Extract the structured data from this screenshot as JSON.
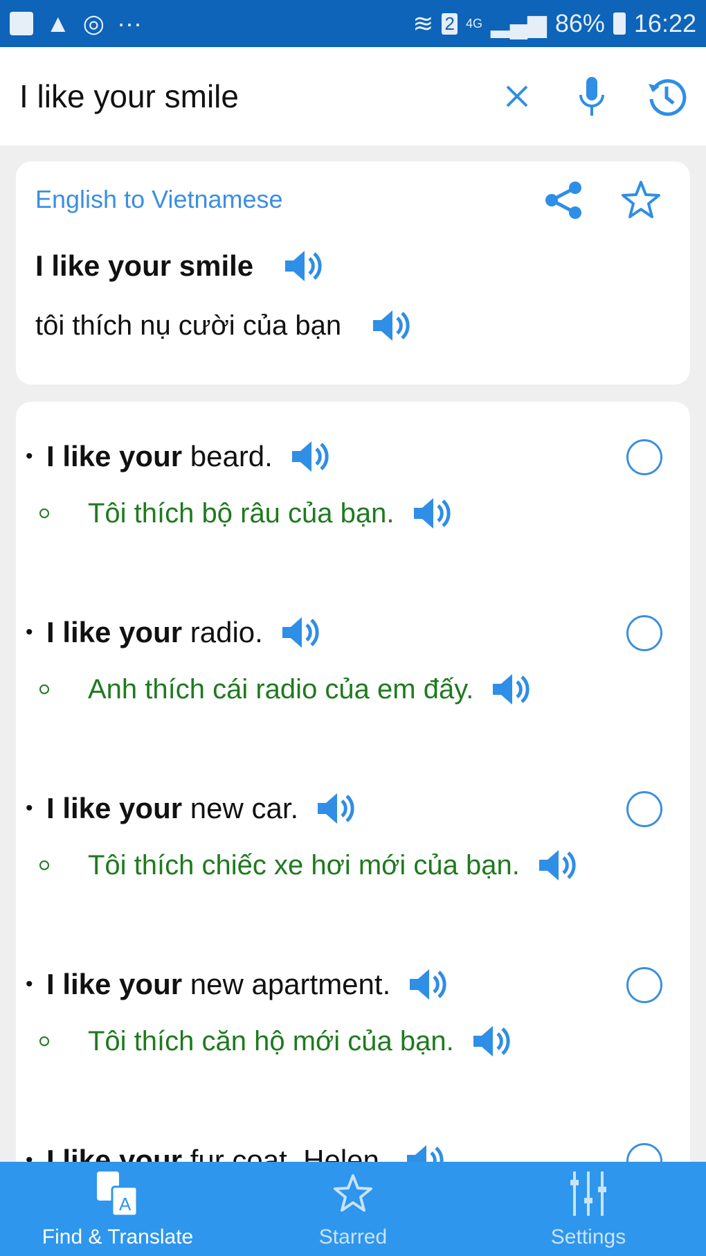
{
  "status_bar": {
    "battery": "86%",
    "time": "16:22",
    "sim": "2",
    "network": "4G"
  },
  "search": {
    "query": "I like your smile",
    "icons": [
      "close-icon",
      "microphone-icon",
      "history-icon"
    ]
  },
  "result": {
    "direction": "English to Vietnamese",
    "source": "I like your smile",
    "translation": "tôi thích nụ cười của bạn"
  },
  "examples": [
    {
      "bold": "I like your",
      "rest": " beard.",
      "translation": "Tôi thích bộ râu của bạn."
    },
    {
      "bold": "I like your",
      "rest": " radio.",
      "translation": "Anh thích cái radio của em đấy."
    },
    {
      "bold": "I like your",
      "rest": " new car.",
      "translation": "Tôi thích chiếc xe hơi mới của bạn."
    },
    {
      "bold": "I like your",
      "rest": " new apartment.",
      "translation": "Tôi thích căn hộ mới của bạn."
    },
    {
      "bold": "I like your",
      "rest": " fur coat, Helen."
    }
  ],
  "nav": [
    {
      "label": "Find & Translate",
      "active": true
    },
    {
      "label": "Starred"
    },
    {
      "label": "Settings"
    }
  ],
  "colors": {
    "accent": "#2e96ec",
    "status_bar": "#0d64b8",
    "translation_green": "#1e7a1e"
  }
}
